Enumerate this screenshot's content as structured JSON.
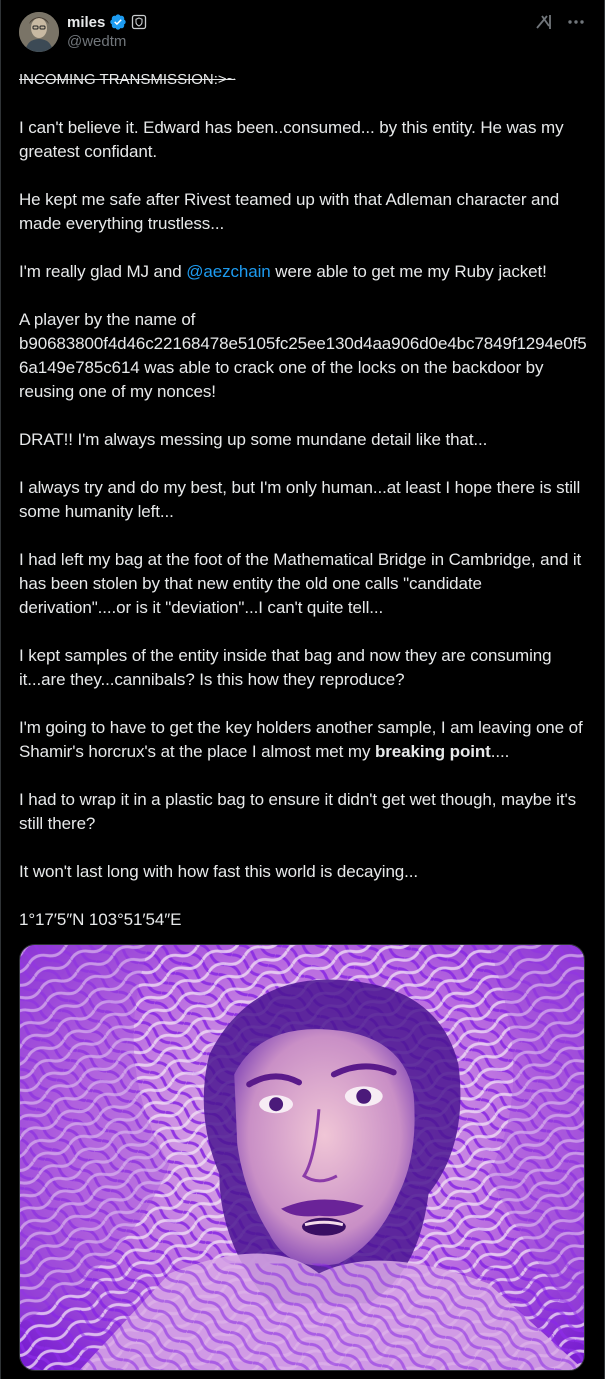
{
  "author": {
    "name": "miles",
    "handle": "@wedtm",
    "verified": true,
    "avatar": "avatar-photo"
  },
  "icons": {
    "verified": "verified-badge-icon",
    "affiliate": "affiliate-badge-icon",
    "grok": "grok-icon",
    "more": "more-icon"
  },
  "colors": {
    "accent": "#1d9bf0",
    "background": "#000000",
    "text": "#e7e9ea",
    "muted": "#71767b"
  },
  "post": {
    "header_line": "INCOMING TRANSMISSION:>~",
    "p1": "I can't believe it. Edward has been..consumed... by this entity. He was my greatest confidant.",
    "p2": "He kept me safe after Rivest teamed up with that Adleman character and made everything trustless...",
    "p3_before": "I'm really glad MJ and ",
    "p3_mention": "@aezchain",
    "p3_after": " were able to get me my Ruby jacket!",
    "p4_a": "A player by the name of",
    "p4_hash": "b90683800f4d46c22168478e5105fc25ee130d4aa906d0e4bc7849f1294e0f56a149e785c614",
    "p4_b": " was able to crack one of the locks on the backdoor by reusing one of my nonces!",
    "p5": "DRAT!! I'm always messing up some mundane detail like that...",
    "p6": "I always try and do my best, but I'm only human...at least I hope there is still some humanity left...",
    "p7": "I had left my bag at the foot of the Mathematical Bridge in Cambridge, and it has been stolen by that new entity the old one calls \"candidate derivation\"....or is it \"deviation\"...I can't quite tell...",
    "p8": "I kept samples of the entity inside that bag and now they are consuming it...are they...cannibals? Is this how they reproduce?",
    "p9_before": "I'm going to have to get the key holders another sample, I am leaving one of Shamir's horcrux's at the place I almost met my ",
    "p9_bold": "breaking point",
    "p9_after": "....",
    "p10": "I had to wrap it in a plastic bag to ensure it didn't get wet though, maybe it's still there?",
    "p11": "It won't last long with how fast this world is decaying...",
    "p12": "1°17′5″N 103°51′54″E"
  }
}
